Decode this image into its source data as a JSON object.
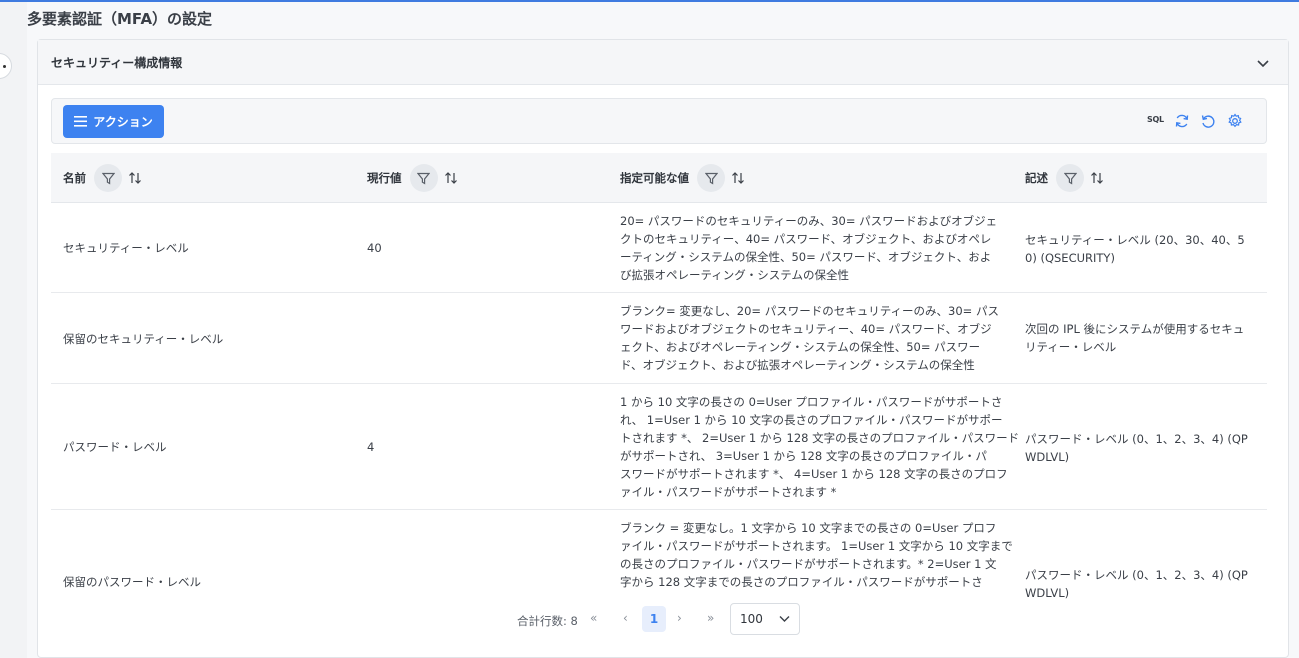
{
  "page": {
    "title": "多要素認証（MFA）の設定"
  },
  "card": {
    "title": "セキュリティー構成情報"
  },
  "toolbar": {
    "action_label": "アクション",
    "sql_label": "SQL"
  },
  "columns": [
    {
      "label": "名前"
    },
    {
      "label": "現行値"
    },
    {
      "label": "指定可能な値"
    },
    {
      "label": "記述"
    }
  ],
  "rows": [
    {
      "name": "セキュリティー・レベル",
      "value": "40",
      "allowed": [
        "20= パスワードのセキュリティーのみ、30= パスワードおよびオブジェ",
        "クトのセキュリティー、40= パスワード、オブジェクト、およびオペレ",
        "ーティング・システムの保全性、50= パスワード、オブジェクト、およ",
        "び拡張オペレーティング・システムの保全性"
      ],
      "description": [
        "セキュリティー・レベル (20、30、40、5",
        "0) (QSECURITY)"
      ]
    },
    {
      "name": "保留のセキュリティー・レベル",
      "value": "",
      "allowed": [
        "ブランク= 変更なし、20= パスワードのセキュリティーのみ、30= パス",
        "ワードおよびオブジェクトのセキュリティー、40= パスワード、オブジ",
        "ェクト、およびオペレーティング・システムの保全性、50= パスワー",
        "ド、オブジェクト、および拡張オペレーティング・システムの保全性"
      ],
      "description": [
        "次回の IPL 後にシステムが使用するセキュ",
        "リティー・レベル"
      ]
    },
    {
      "name": "パスワード・レベル",
      "value": "4",
      "allowed": [
        "1 から 10 文字の長さの 0=User プロファイル・パスワードがサポートさ",
        "れ、 1=User 1 から 10 文字の長さのプロファイル・パスワードがサポー",
        "トされます *、 2=User 1 から 128 文字の長さのプロファイル・パスワード",
        "がサポートされ、 3=User 1 から 128 文字の長さのプロファイル・パ",
        "スワードがサポートされます *、 4=User 1 から 128 文字の長さのプロフ",
        "ァイル・パスワードがサポートされます *"
      ],
      "description": [
        "パスワード・レベル (0、1、2、3、4) (QP",
        "WDLVL)"
      ]
    },
    {
      "name": "保留のパスワード・レベル",
      "value": "",
      "allowed": [
        "ブランク = 変更なし。1 文字から 10 文字までの長さの 0=User プロフ",
        "ァイル・パスワードがサポートされます。 1=User 1 文字から 10 文字まで",
        "の長さのプロファイル・パスワードがサポートされます。* 2=User 1 文",
        "字から 128 文字までの長さのプロファイル・パスワードがサポートさ"
      ],
      "description": [
        "パスワード・レベル (0、1、2、3、4) (QP",
        "WDLVL)"
      ]
    }
  ],
  "pagination": {
    "total_label": "合計行数: 8",
    "first": "«",
    "prev": "‹",
    "current": "1",
    "next": "›",
    "last": "»",
    "page_size": "100"
  }
}
